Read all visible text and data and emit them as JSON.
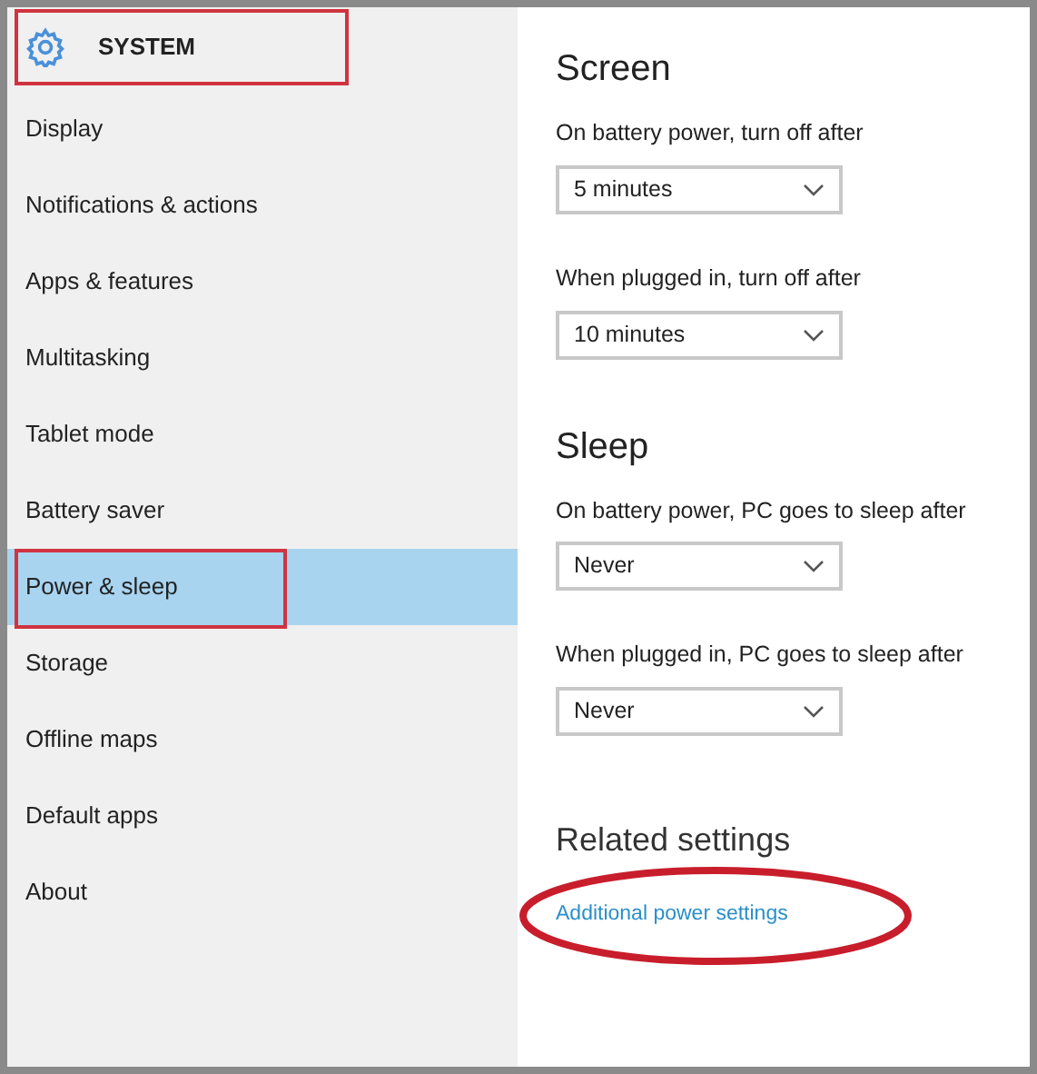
{
  "header": {
    "title": "SYSTEM",
    "highlighted": true
  },
  "sidebar": {
    "items": [
      {
        "label": "Display",
        "selected": false,
        "highlighted": false
      },
      {
        "label": "Notifications & actions",
        "selected": false,
        "highlighted": false
      },
      {
        "label": "Apps & features",
        "selected": false,
        "highlighted": false
      },
      {
        "label": "Multitasking",
        "selected": false,
        "highlighted": false
      },
      {
        "label": "Tablet mode",
        "selected": false,
        "highlighted": false
      },
      {
        "label": "Battery saver",
        "selected": false,
        "highlighted": false
      },
      {
        "label": "Power & sleep",
        "selected": true,
        "highlighted": true
      },
      {
        "label": "Storage",
        "selected": false,
        "highlighted": false
      },
      {
        "label": "Offline maps",
        "selected": false,
        "highlighted": false
      },
      {
        "label": "Default apps",
        "selected": false,
        "highlighted": false
      },
      {
        "label": "About",
        "selected": false,
        "highlighted": false
      }
    ]
  },
  "sections": [
    {
      "title": "Screen",
      "settings": [
        {
          "label": "On battery power, turn off after",
          "value": "5 minutes"
        },
        {
          "label": "When plugged in, turn off after",
          "value": "10 minutes"
        }
      ]
    },
    {
      "title": "Sleep",
      "settings": [
        {
          "label": "On battery power, PC goes to sleep after",
          "value": "Never"
        },
        {
          "label": "When plugged in, PC goes to sleep after",
          "value": "Never"
        }
      ]
    }
  ],
  "related": {
    "title": "Related settings",
    "link": "Additional power settings",
    "circled": true
  }
}
